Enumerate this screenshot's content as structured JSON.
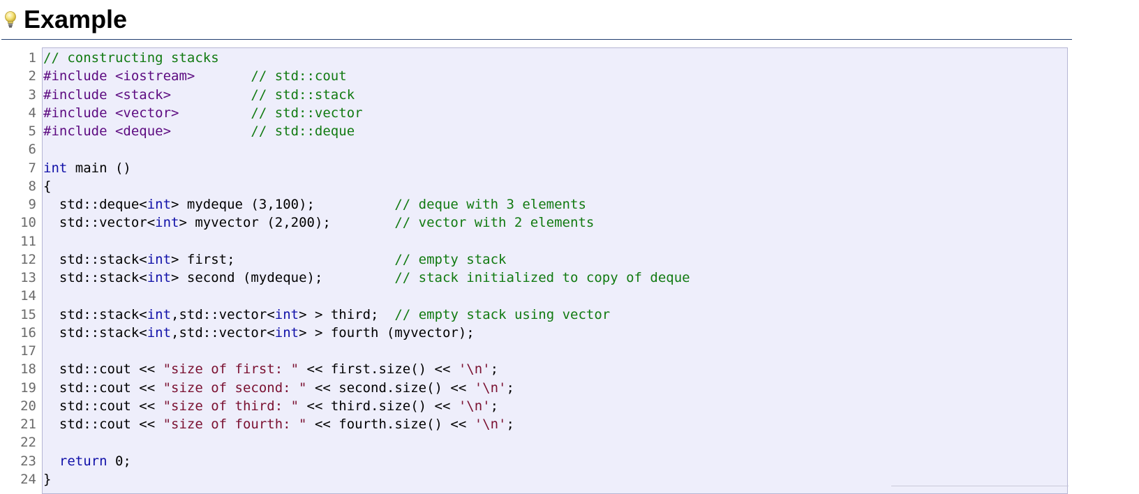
{
  "section": {
    "title": "Example",
    "icon": "lightbulb-icon"
  },
  "colors": {
    "comment": "#117a11",
    "preprocessor": "#5c0a80",
    "keyword": "#1010a8",
    "string": "#7a1030",
    "code_background": "#eeeefb",
    "code_border": "#b5b5d4",
    "line_number": "#6b6b6b",
    "header_rule": "#1f3d6e"
  },
  "code": {
    "language": "cpp",
    "lines": [
      [
        {
          "t": "comment",
          "v": "// constructing stacks"
        }
      ],
      [
        {
          "t": "preproc",
          "v": "#include <iostream>"
        },
        {
          "t": "plain",
          "v": "       "
        },
        {
          "t": "comment",
          "v": "// std::cout"
        }
      ],
      [
        {
          "t": "preproc",
          "v": "#include <stack>"
        },
        {
          "t": "plain",
          "v": "          "
        },
        {
          "t": "comment",
          "v": "// std::stack"
        }
      ],
      [
        {
          "t": "preproc",
          "v": "#include <vector>"
        },
        {
          "t": "plain",
          "v": "         "
        },
        {
          "t": "comment",
          "v": "// std::vector"
        }
      ],
      [
        {
          "t": "preproc",
          "v": "#include <deque>"
        },
        {
          "t": "plain",
          "v": "          "
        },
        {
          "t": "comment",
          "v": "// std::deque"
        }
      ],
      [],
      [
        {
          "t": "keyword",
          "v": "int"
        },
        {
          "t": "plain",
          "v": " main ()"
        }
      ],
      [
        {
          "t": "plain",
          "v": "{"
        }
      ],
      [
        {
          "t": "plain",
          "v": "  std::deque<"
        },
        {
          "t": "keyword",
          "v": "int"
        },
        {
          "t": "plain",
          "v": "> mydeque (3,100);          "
        },
        {
          "t": "comment",
          "v": "// deque with 3 elements"
        }
      ],
      [
        {
          "t": "plain",
          "v": "  std::vector<"
        },
        {
          "t": "keyword",
          "v": "int"
        },
        {
          "t": "plain",
          "v": "> myvector (2,200);        "
        },
        {
          "t": "comment",
          "v": "// vector with 2 elements"
        }
      ],
      [],
      [
        {
          "t": "plain",
          "v": "  std::stack<"
        },
        {
          "t": "keyword",
          "v": "int"
        },
        {
          "t": "plain",
          "v": "> first;                    "
        },
        {
          "t": "comment",
          "v": "// empty stack"
        }
      ],
      [
        {
          "t": "plain",
          "v": "  std::stack<"
        },
        {
          "t": "keyword",
          "v": "int"
        },
        {
          "t": "plain",
          "v": "> second (mydeque);         "
        },
        {
          "t": "comment",
          "v": "// stack initialized to copy of deque"
        }
      ],
      [],
      [
        {
          "t": "plain",
          "v": "  std::stack<"
        },
        {
          "t": "keyword",
          "v": "int"
        },
        {
          "t": "plain",
          "v": ",std::vector<"
        },
        {
          "t": "keyword",
          "v": "int"
        },
        {
          "t": "plain",
          "v": "> > third;  "
        },
        {
          "t": "comment",
          "v": "// empty stack using vector"
        }
      ],
      [
        {
          "t": "plain",
          "v": "  std::stack<"
        },
        {
          "t": "keyword",
          "v": "int"
        },
        {
          "t": "plain",
          "v": ",std::vector<"
        },
        {
          "t": "keyword",
          "v": "int"
        },
        {
          "t": "plain",
          "v": "> > fourth (myvector);"
        }
      ],
      [],
      [
        {
          "t": "plain",
          "v": "  std::cout << "
        },
        {
          "t": "string",
          "v": "\"size of first: \""
        },
        {
          "t": "plain",
          "v": " << first.size() << "
        },
        {
          "t": "string",
          "v": "'\\n'"
        },
        {
          "t": "plain",
          "v": ";"
        }
      ],
      [
        {
          "t": "plain",
          "v": "  std::cout << "
        },
        {
          "t": "string",
          "v": "\"size of second: \""
        },
        {
          "t": "plain",
          "v": " << second.size() << "
        },
        {
          "t": "string",
          "v": "'\\n'"
        },
        {
          "t": "plain",
          "v": ";"
        }
      ],
      [
        {
          "t": "plain",
          "v": "  std::cout << "
        },
        {
          "t": "string",
          "v": "\"size of third: \""
        },
        {
          "t": "plain",
          "v": " << third.size() << "
        },
        {
          "t": "string",
          "v": "'\\n'"
        },
        {
          "t": "plain",
          "v": ";"
        }
      ],
      [
        {
          "t": "plain",
          "v": "  std::cout << "
        },
        {
          "t": "string",
          "v": "\"size of fourth: \""
        },
        {
          "t": "plain",
          "v": " << fourth.size() << "
        },
        {
          "t": "string",
          "v": "'\\n'"
        },
        {
          "t": "plain",
          "v": ";"
        }
      ],
      [],
      [
        {
          "t": "plain",
          "v": "  "
        },
        {
          "t": "keyword",
          "v": "return"
        },
        {
          "t": "plain",
          "v": " 0;"
        }
      ],
      [
        {
          "t": "plain",
          "v": "}"
        }
      ]
    ]
  }
}
